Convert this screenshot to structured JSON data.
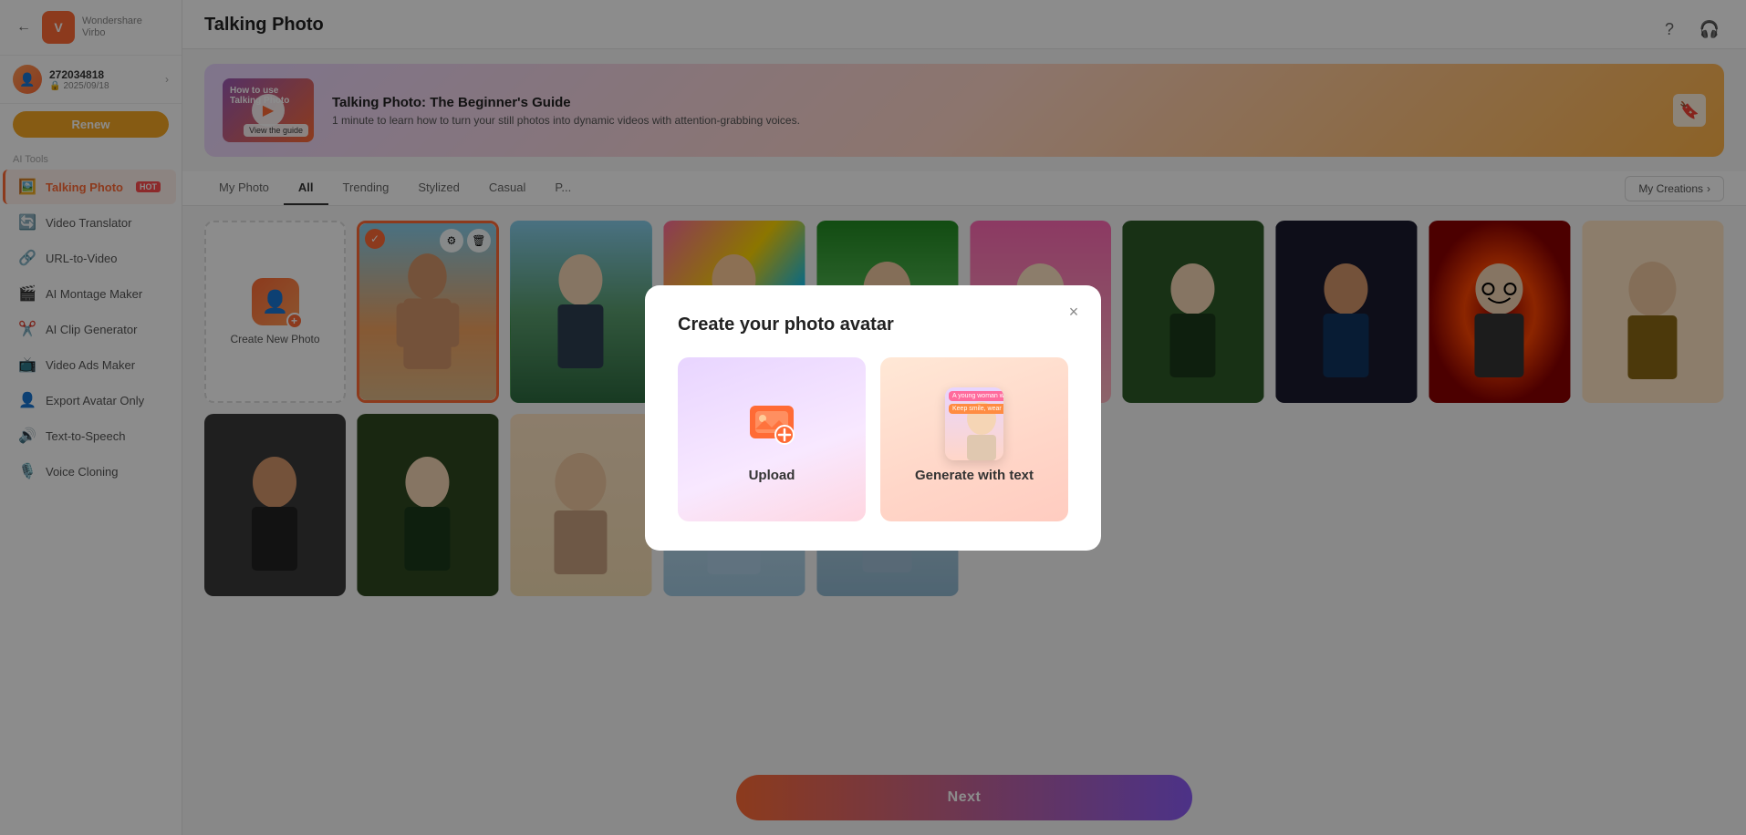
{
  "sidebar": {
    "brand_name": "Wondershare",
    "brand_product": "Virbo",
    "user_id": "272034818",
    "user_date": "2025/09/18",
    "renew_label": "Renew",
    "section_label": "AI Tools",
    "items": [
      {
        "id": "talking-photo",
        "label": "Talking Photo",
        "icon": "🖼️",
        "hot": true,
        "active": true
      },
      {
        "id": "video-translator",
        "label": "Video Translator",
        "icon": "🔄",
        "hot": false,
        "active": false
      },
      {
        "id": "url-to-video",
        "label": "URL-to-Video",
        "icon": "🔗",
        "hot": false,
        "active": false
      },
      {
        "id": "ai-montage-maker",
        "label": "AI Montage Maker",
        "icon": "🎬",
        "hot": false,
        "active": false
      },
      {
        "id": "ai-clip-generator",
        "label": "AI Clip Generator",
        "icon": "✂️",
        "hot": false,
        "active": false
      },
      {
        "id": "video-ads-maker",
        "label": "Video Ads Maker",
        "icon": "📺",
        "hot": false,
        "active": false
      },
      {
        "id": "export-avatar-only",
        "label": "Export Avatar Only",
        "icon": "👤",
        "hot": false,
        "active": false
      },
      {
        "id": "text-to-speech",
        "label": "Text-to-Speech",
        "icon": "🔊",
        "hot": false,
        "active": false
      },
      {
        "id": "voice-cloning",
        "label": "Voice Cloning",
        "icon": "🎙️",
        "hot": false,
        "active": false
      }
    ]
  },
  "main": {
    "title": "Talking Photo",
    "guide_banner": {
      "title": "Talking Photo: The Beginner's Guide",
      "desc": "1 minute to learn how to turn your still photos into dynamic videos with attention-grabbing voices.",
      "thumb_label1": "How to use",
      "thumb_label2": "Talking Photo",
      "view_guide": "View the guide"
    },
    "filter_tabs": [
      {
        "id": "my-photo",
        "label": "My Photo",
        "active": false
      },
      {
        "id": "all",
        "label": "All",
        "active": true
      },
      {
        "id": "trending",
        "label": "Trending",
        "active": false
      },
      {
        "id": "stylized",
        "label": "Stylized",
        "active": false
      },
      {
        "id": "casual",
        "label": "Casual",
        "active": false
      },
      {
        "id": "more",
        "label": "P...",
        "active": false
      }
    ],
    "creations_btn": "My Creations",
    "create_new_label": "Create New Photo",
    "next_btn": "Next"
  },
  "modal": {
    "title": "Create your photo avatar",
    "upload_label": "Upload",
    "generate_label": "Generate with text",
    "close_icon": "×"
  },
  "header_icons": {
    "help": "?",
    "settings": "⚙"
  }
}
